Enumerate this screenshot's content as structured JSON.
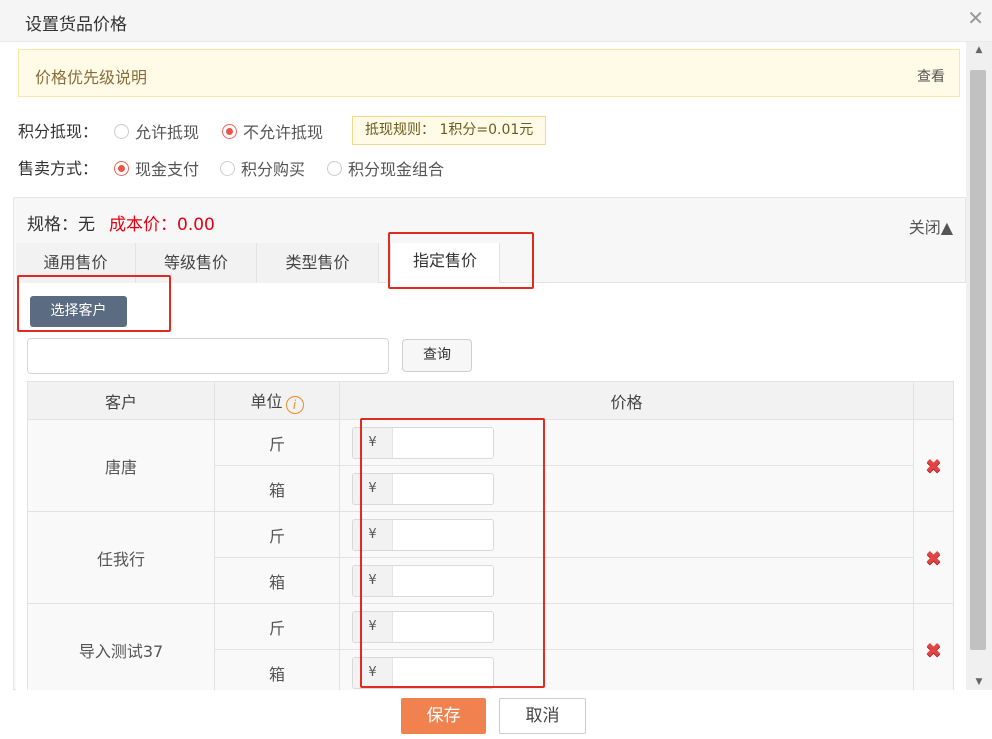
{
  "dialog": {
    "title": "设置货品价格",
    "close_icon": "close-icon"
  },
  "notice": {
    "text": "价格优先级说明",
    "link": "查看"
  },
  "points_deduction": {
    "label": "积分抵现：",
    "options": [
      "允许抵现",
      "不允许抵现"
    ],
    "selected": "不允许抵现",
    "rule": "抵现规则： 1积分=0.01元"
  },
  "sale_method": {
    "label": "售卖方式：",
    "options": [
      "现金支付",
      "积分购买",
      "积分现金组合"
    ],
    "selected": "现金支付"
  },
  "spec": {
    "label": "规格：无",
    "cost": "成本价：0.00",
    "toggle": "关闭▲",
    "tabs": [
      "通用售价",
      "等级售价",
      "类型售价",
      "指定售价"
    ],
    "active_tab": "指定售价"
  },
  "customer_tab": {
    "select_button": "选择客户",
    "search_placeholder": "",
    "query_button": "查询",
    "columns": [
      "客户",
      "单位",
      "价格"
    ],
    "unit_info_icon": "i",
    "currency": "¥",
    "rows": [
      {
        "customer": "唐唐",
        "units": [
          "斤",
          "箱"
        ]
      },
      {
        "customer": "任我行",
        "units": [
          "斤",
          "箱"
        ]
      },
      {
        "customer": "导入测试37",
        "units": [
          "斤",
          "箱"
        ]
      }
    ],
    "delete_icon": "✖"
  },
  "footer": {
    "save": "保存",
    "cancel": "取消"
  },
  "colors": {
    "accent": "#f08250",
    "highlight": "#e02b20",
    "cost": "#e60012"
  }
}
